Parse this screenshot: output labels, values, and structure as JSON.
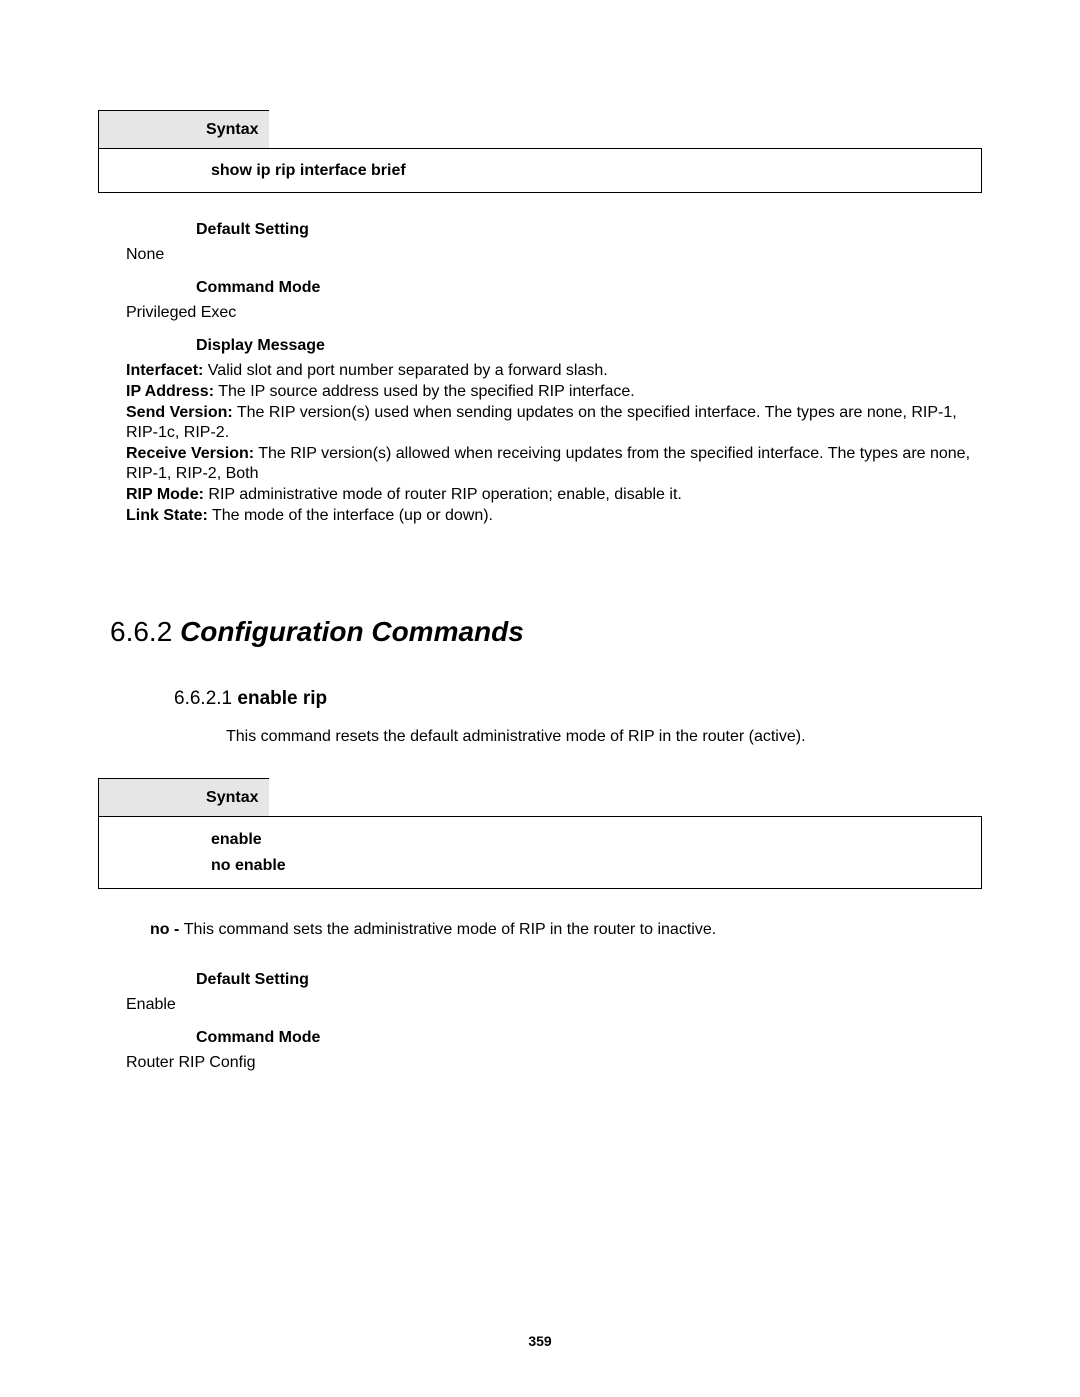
{
  "syntax1": {
    "label": "Syntax",
    "command": "show ip rip interface brief"
  },
  "block1": {
    "defaultSettingLabel": "Default Setting",
    "defaultSettingValue": "None",
    "commandModeLabel": "Command Mode",
    "commandModeValue": "Privileged Exec",
    "displayMessageLabel": "Display Message",
    "defs": {
      "interfacet": {
        "term": "Interfacet:",
        "desc": " Valid slot and port number separated by a forward slash."
      },
      "ipaddress": {
        "term": "IP Address:",
        "desc": " The IP source address used by the specified RIP interface."
      },
      "sendversion": {
        "term": "Send Version:",
        "desc": " The RIP version(s) used when sending updates on the specified interface. The types are none, RIP-1, RIP-1c, RIP-2."
      },
      "receiveversion": {
        "term": "Receive Version:",
        "desc": " The RIP version(s) allowed when receiving updates from the specified interface. The types are none, RIP-1, RIP-2, Both"
      },
      "ripmode": {
        "term": "RIP Mode:",
        "desc": " RIP administrative mode of router RIP operation; enable, disable it."
      },
      "linkstate": {
        "term": "Link State:",
        "desc": " The mode of the interface (up or down)."
      }
    }
  },
  "section": {
    "number": "6.6.2 ",
    "title": "Configuration Commands"
  },
  "subsection": {
    "number": "6.6.2.1 ",
    "title": "enable rip",
    "description": "This command resets the default administrative mode of RIP in the router (active)."
  },
  "syntax2": {
    "label": "Syntax",
    "line1": "enable",
    "line2": "no enable"
  },
  "noNote": {
    "term": "no - ",
    "desc": "This command sets the administrative mode of RIP in the router to inactive."
  },
  "block2": {
    "defaultSettingLabel": "Default Setting",
    "defaultSettingValue": "Enable",
    "commandModeLabel": "Command Mode",
    "commandModeValue": "Router RIP Config"
  },
  "pageNumber": "359"
}
